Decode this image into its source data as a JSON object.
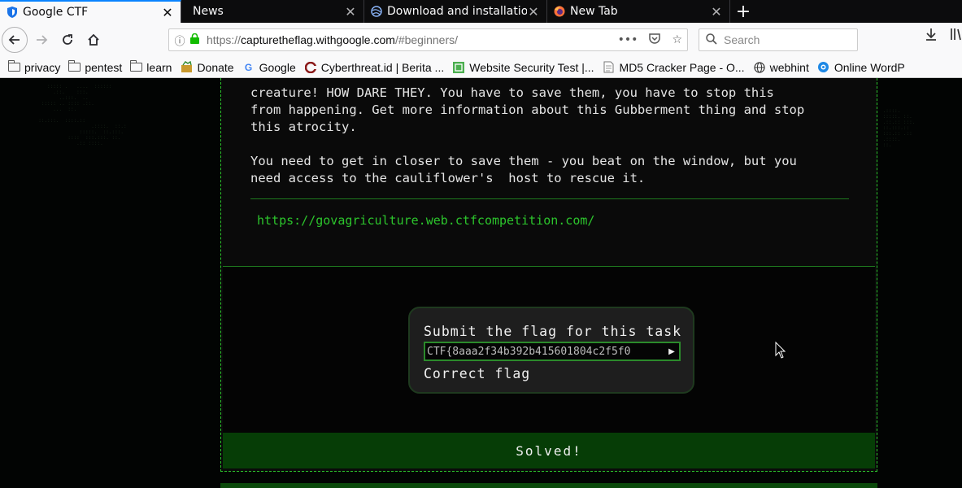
{
  "tabs": [
    {
      "title": "Google CTF",
      "active": true,
      "icon": "shield-icon"
    },
    {
      "title": "News",
      "active": false,
      "icon": ""
    },
    {
      "title": "Download and installatio",
      "active": false,
      "icon": "globe-icon"
    },
    {
      "title": "New Tab",
      "active": false,
      "icon": "firefox-icon"
    }
  ],
  "navbar": {
    "url_prefix": "https://",
    "url_host": "capturetheflag.withgoogle.com",
    "url_path": "/#beginners/",
    "search_placeholder": "Search"
  },
  "bookmarks": [
    {
      "label": "privacy",
      "icon": "folder-icon"
    },
    {
      "label": "pentest",
      "icon": "folder-icon"
    },
    {
      "label": "learn",
      "icon": "folder-icon"
    },
    {
      "label": "Donate",
      "icon": "donate-icon"
    },
    {
      "label": "Google",
      "icon": "google-icon"
    },
    {
      "label": "Cyberthreat.id | Berita ...",
      "icon": "cyberthreat-icon"
    },
    {
      "label": "Website Security Test |...",
      "icon": "security-test-icon"
    },
    {
      "label": "MD5 Cracker Page - O...",
      "icon": "md5-icon"
    },
    {
      "label": "webhint",
      "icon": "globe-icon"
    },
    {
      "label": "Online WordP",
      "icon": "wordpress-icon"
    }
  ],
  "task": {
    "description": "creature! HOW DARE THEY. You have to save them, you have to stop this\nfrom happening. Get more information about this Gubberment thing and stop\nthis atrocity.\n\nYou need to get in closer to save them - you beat on the window, but you\nneed access to the cauliflower's  host to rescue it.",
    "link": "https://govagriculture.web.ctfcompetition.com/"
  },
  "flag": {
    "title": "Submit the flag for this task",
    "value": "CTF{8aaa2f34b392b415601804c2f5f0",
    "status": "Correct flag"
  },
  "solved_label": "Solved!",
  "colors": {
    "accent": "#2cc52c",
    "solved_bg": "#063d06",
    "panel_bg": "#0a0a0a"
  }
}
